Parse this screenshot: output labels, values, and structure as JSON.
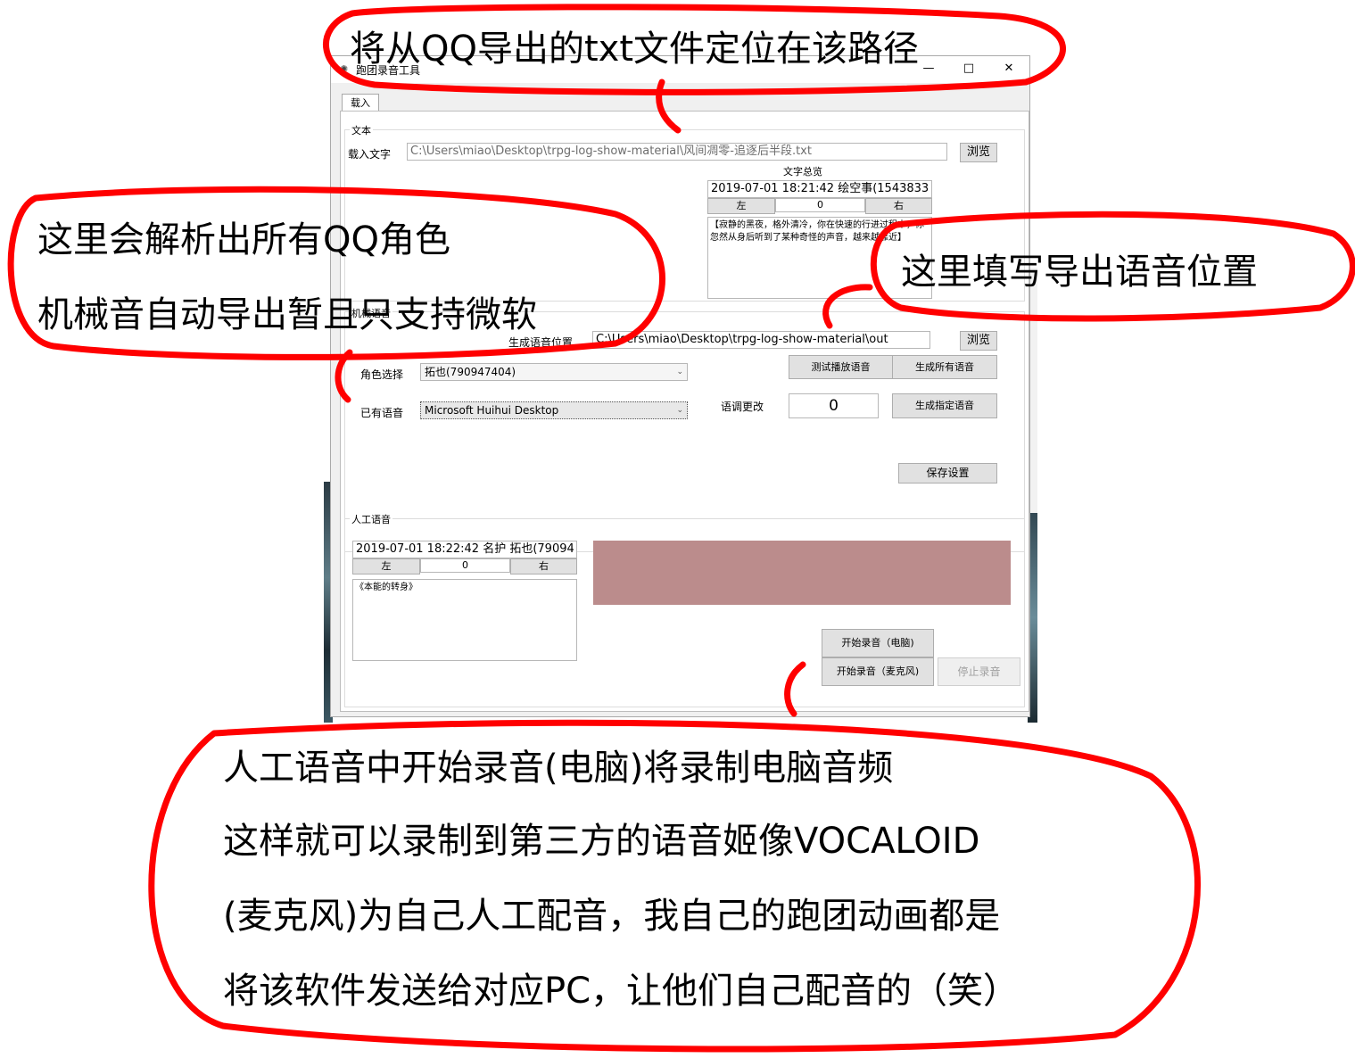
{
  "window": {
    "title": "跑团录音工具",
    "tab_label": "载入",
    "minimize": "—",
    "maximize": "□",
    "close": "✕"
  },
  "text_group": {
    "label": "文本",
    "load_text_label": "载入文字",
    "file_path": "C:\\Users\\miao\\Desktop\\trpg-log-show-material\\风间凋零-追逐后半段.txt",
    "browse_label": "浏览",
    "preview_title": "文字总览",
    "preview_header": "2019-07-01 18:21:42 绘空事(1543833",
    "left_label": "左",
    "right_label": "右",
    "index_value": "0",
    "preview_content": "【寂静的黑夜，格外清冷，你在快速的行进过程中，你忽然从身后听到了某种奇怪的声音，越来越靠近】"
  },
  "machine_group": {
    "label": "机械语音",
    "output_label": "生成语音位置",
    "output_path": "C:\\Users\\miao\\Desktop\\trpg-log-show-material\\out",
    "browse_label": "浏览",
    "role_label": "角色选择",
    "role_value": "拓也(790947404)",
    "voice_label": "已有语音",
    "voice_value": "Microsoft Huihui Desktop",
    "test_play_label": "测试播放语音",
    "generate_all_label": "生成所有语音",
    "pitch_label": "语调更改",
    "pitch_value": "0",
    "generate_selected_label": "生成指定语音",
    "save_label": "保存设置"
  },
  "manual_group": {
    "label": "人工语音",
    "header": "2019-07-01 18:22:42 名护 拓也(79094",
    "left_label": "左",
    "right_label": "右",
    "index_value": "0",
    "content": "《本能的转身》",
    "swatch_color": "#bb8c8c",
    "start_pc_label": "开始录音（电脑)",
    "start_mic_label": "开始录音（麦克风)",
    "stop_label": "停止录音"
  },
  "annotations": {
    "top": "将从QQ导出的txt文件定位在该路径",
    "left_line1": "这里会解析出所有QQ角色",
    "left_line2": "机械音自动导出暂且只支持微软",
    "right": "这里填写导出语音位置",
    "bottom_line1": "人工语音中开始录音(电脑)将录制电脑音频",
    "bottom_line2": "这样就可以录制到第三方的语音姬像VOCALOID",
    "bottom_line3": "(麦克风)为自己人工配音，我自己的跑团动画都是",
    "bottom_line4": "将该软件发送给对应PC，让他们自己配音的（笑）",
    "ink_color": "#ff0000"
  }
}
